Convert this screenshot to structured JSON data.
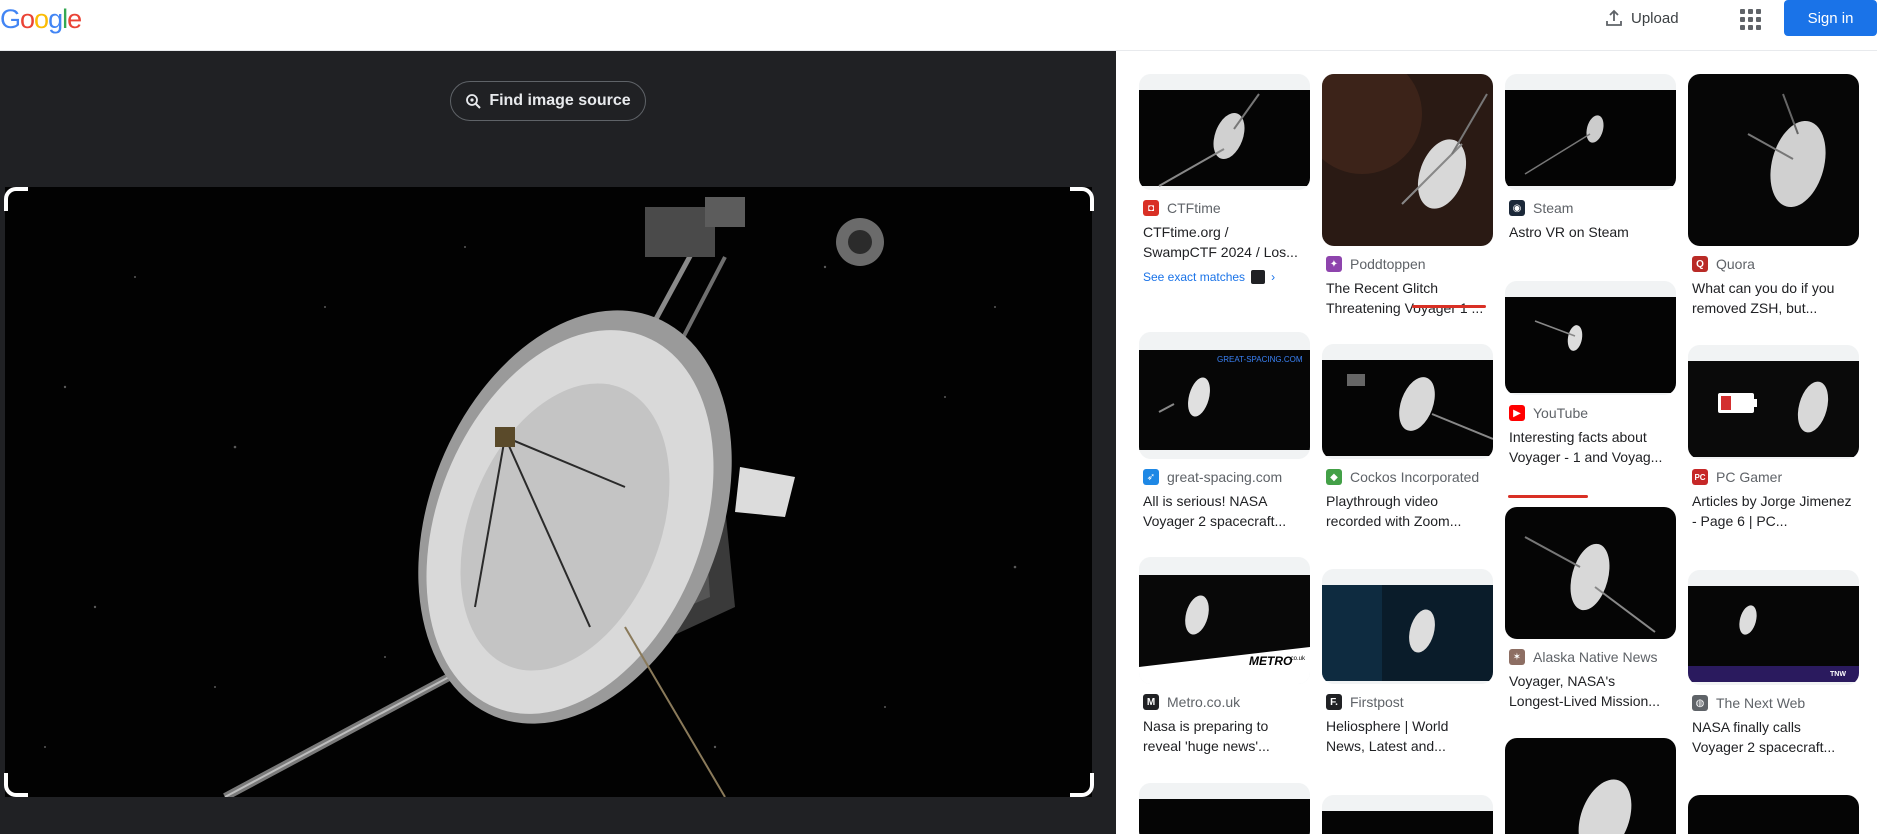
{
  "header": {
    "logo_letters": [
      "G",
      "o",
      "o",
      "g",
      "l",
      "e"
    ],
    "logo_colors": [
      "#4285f4",
      "#ea4335",
      "#fbbc05",
      "#4285f4",
      "#34a853",
      "#ea4335"
    ],
    "upload_label": "Upload",
    "signin_label": "Sign in"
  },
  "viewer": {
    "find_source_label": "Find image source"
  },
  "results": [
    {
      "source": "CTFtime",
      "title": "CTFtime.org / SwampCTF 2024 / Los...",
      "fav_color": "#d93025",
      "fav_glyph": "◘",
      "exact": "See exact matches"
    },
    {
      "source": "Poddtoppen",
      "title": "The Recent Glitch Threatening Voyager 1 ...",
      "fav_color": "#8e44ad",
      "fav_glyph": "✦"
    },
    {
      "source": "Steam",
      "title": "Astro VR on Steam",
      "fav_color": "#1b2838",
      "fav_glyph": "◉"
    },
    {
      "source": "Quora",
      "title": "What can you do if you removed ZSH, but...",
      "fav_color": "#b92b27",
      "fav_glyph": "Q"
    },
    {
      "source": "great-spacing.com",
      "title": "All is serious! NASA Voyager 2 spacecraft...",
      "fav_color": "#1e88e5",
      "fav_glyph": "➶"
    },
    {
      "source": "Cockos Incorporated",
      "title": "Playthrough video recorded with Zoom...",
      "fav_color": "#43a047",
      "fav_glyph": "◆"
    },
    {
      "source": "YouTube",
      "title": "Interesting facts about Voyager - 1 and Voyag...",
      "fav_color": "#ff0000",
      "fav_glyph": "▶"
    },
    {
      "source": "PC Gamer",
      "title": "Articles by Jorge Jimenez - Page 6 | PC...",
      "fav_color": "#c62828",
      "fav_glyph": "PC"
    },
    {
      "source": "Metro.co.uk",
      "title": "Nasa is preparing to reveal 'huge news'...",
      "fav_color": "#202124",
      "fav_glyph": "M"
    },
    {
      "source": "Firstpost",
      "title": "Heliosphere | World News, Latest and...",
      "fav_color": "#202124",
      "fav_glyph": "F."
    },
    {
      "source": "Alaska Native News",
      "title": "Voyager, NASA's Longest-Lived Mission...",
      "fav_color": "#8d6e63",
      "fav_glyph": "✶"
    },
    {
      "source": "The Next Web",
      "title": "NASA finally calls Voyager 2 spacecraft...",
      "fav_color": "#5f6368",
      "fav_glyph": "◍"
    }
  ],
  "thumb_overlays": {
    "great_spacing_watermark": "GREAT-SPACING.COM",
    "metro_watermark": "METRO",
    "metro_watermark_suffix": ".co.uk",
    "tnw_watermark": "TNW"
  }
}
